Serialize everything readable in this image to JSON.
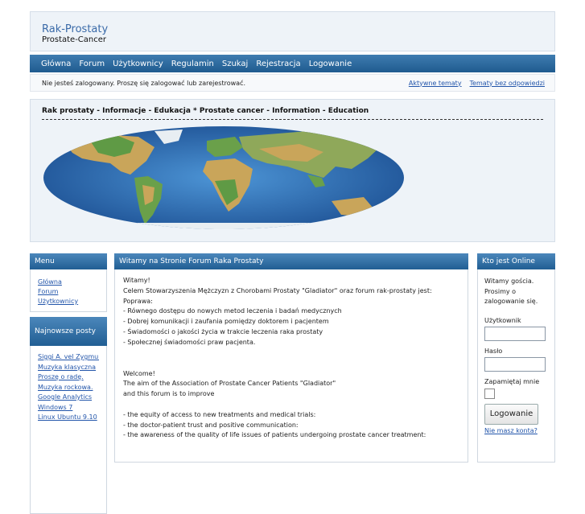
{
  "site": {
    "title": "Rak-Prostaty",
    "subtitle": "Prostate-Cancer"
  },
  "nav": [
    "Główna",
    "Forum",
    "Użytkownicy",
    "Regulamin",
    "Szukaj",
    "Rejestracja",
    "Logowanie"
  ],
  "status": {
    "message": "Nie jesteś zalogowany. Proszę się zalogować lub zarejestrować.",
    "link1": "Aktywne tematy",
    "link2": "Tematy bez odpowiedzi"
  },
  "banner": {
    "title": "Rak prostaty - Informacje - Edukacja * Prostate cancer - Information - Education"
  },
  "menu": {
    "title": "Menu",
    "links": [
      "Główna",
      "Forum",
      "Użytkownicy"
    ]
  },
  "posts": {
    "title": "Najnowsze posty",
    "items": [
      "Siggi A. vel Zygmunt...",
      "Muzyka klasyczna",
      "Proszę o radę.",
      "Muzyka rockowa.",
      "Google Analytics",
      "Windows 7",
      "Linux Ubuntu 9.10"
    ]
  },
  "main": {
    "title": "Witamy na Stronie Forum Raka Prostaty",
    "lines_pl": [
      "Witamy!",
      "Celem Stowarzyszenia Mężczyzn z Chorobami Prostaty \"Gladiator\" oraz forum rak-prostaty jest:",
      "Poprawa:",
      "- Równego dostępu do nowych metod leczenia i badań medycznych",
      "- Dobrej komunikacji i zaufania pomiędzy doktorem i pacjentem",
      "- Świadomości o jakości życia w trakcie leczenia raka prostaty",
      "- Społecznej świadomości praw pacjenta."
    ],
    "lines_en": [
      "Welcome!",
      "The aim of the Association of Prostate Cancer Patients \"Gladiator\"",
      "and this forum is to improve",
      "",
      "- the equity of access to new treatments and medical trials:",
      "- the doctor-patient trust and positive communication:",
      "- the awareness of the quality of life issues of patients undergoing prostate cancer treatment:"
    ]
  },
  "online": {
    "title": "Kto jest Online",
    "welcome": "Witamy gościa. Prosimy o zalogowanie się.",
    "user_label": "Użytkownik",
    "pass_label": "Hasło",
    "remember_label": "Zapamiętaj mnie",
    "login_button": "Logowanie",
    "register_link": "Nie masz konta?"
  }
}
